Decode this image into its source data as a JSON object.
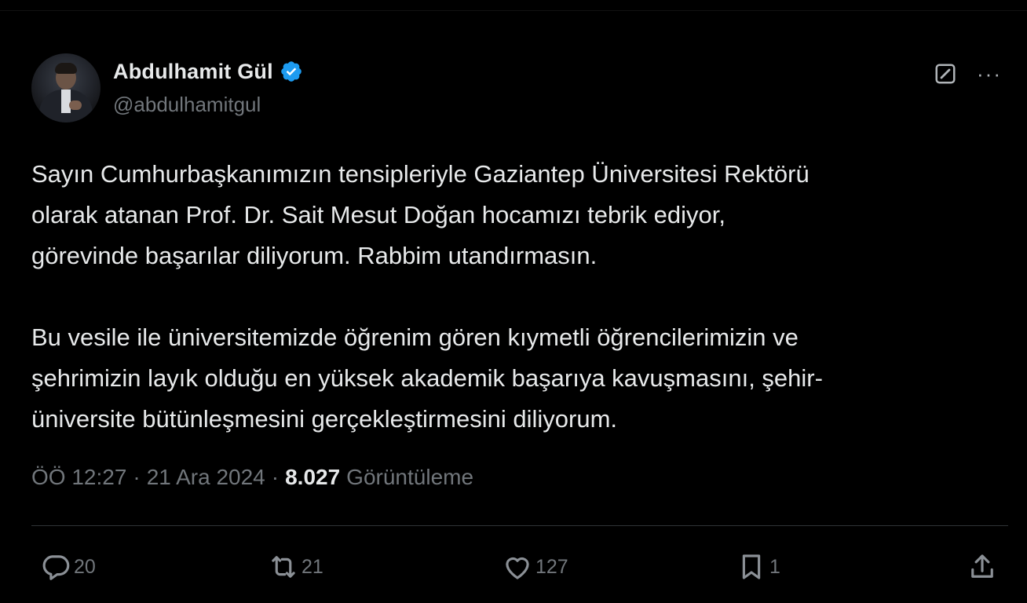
{
  "author": {
    "name": "Abdulhamit Gül",
    "handle": "@abdulhamitgul",
    "verified_color": "#1d9bf0"
  },
  "tweet": {
    "paragraph1": [
      "Sayın Cumhurbaşkanımızın tensipleriyle Gaziantep Üniversitesi Rektörü",
      "olarak atanan Prof. Dr. Sait Mesut Doğan hocamızı tebrik ediyor,",
      "görevinde başarılar diliyorum. Rabbim utandırmasın."
    ],
    "paragraph2": [
      "Bu vesile ile üniversitemizde öğrenim gören kıymetli öğrencilerimizin ve",
      "şehrimizin layık olduğu en yüksek akademik başarıya kavuşmasını, şehir-",
      "üniversite bütünleşmesini gerçekleştirmesini diliyorum."
    ]
  },
  "meta": {
    "time": "ÖÖ 12:27",
    "separator": "·",
    "date": "21 Ara 2024",
    "views_count": "8.027",
    "views_label": "Görüntüleme"
  },
  "actions": {
    "replies": "20",
    "reposts": "21",
    "likes": "127",
    "bookmarks": "1"
  },
  "icons": {
    "verified": "verified-badge-icon",
    "grok": "grok-icon",
    "more": "more-icon",
    "reply": "reply-icon",
    "repost": "repost-icon",
    "like": "heart-icon",
    "bookmark": "bookmark-icon",
    "share": "share-icon"
  },
  "more_glyph": "···"
}
